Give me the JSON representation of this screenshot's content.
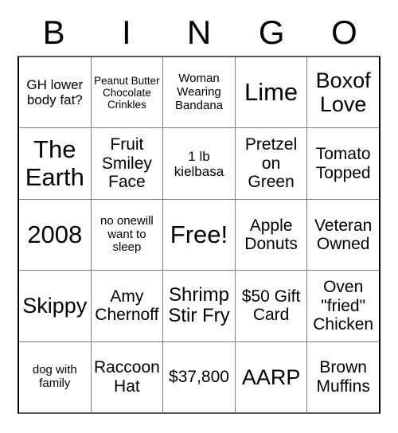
{
  "card": {
    "title_letters": [
      "B",
      "I",
      "N",
      "G",
      "O"
    ],
    "columns": [
      "B",
      "I",
      "N",
      "G",
      "O"
    ],
    "free_space_label": "Free!",
    "colors": {
      "text": "#000000",
      "background": "#ffffff",
      "grid_line": "#808080",
      "outer_border": "#000000"
    },
    "rows": [
      [
        {
          "text": "GH lower body fat?",
          "size": "sm"
        },
        {
          "text": "Peanut Butter Chocolate Crinkles",
          "size": "xxs"
        },
        {
          "text": "Woman Wearing Bandana",
          "size": "xs"
        },
        {
          "text": "Lime",
          "size": "xxl"
        },
        {
          "text": "Boxof Love",
          "size": "xl"
        }
      ],
      [
        {
          "text": "The Earth",
          "size": "xxl"
        },
        {
          "text": "Fruit Smiley Face",
          "size": "md"
        },
        {
          "text": "1 lb kielbasa",
          "size": "sm"
        },
        {
          "text": "Pretzel on Green",
          "size": "md"
        },
        {
          "text": "Tomato Topped",
          "size": "md"
        }
      ],
      [
        {
          "text": "2008",
          "size": "xxl"
        },
        {
          "text": "no onewill want to sleep",
          "size": "xs"
        },
        {
          "text": "Free!",
          "size": "xxl"
        },
        {
          "text": "Apple Donuts",
          "size": "md"
        },
        {
          "text": "Veteran Owned",
          "size": "md"
        }
      ],
      [
        {
          "text": "Skippy",
          "size": "xl"
        },
        {
          "text": "Amy Chernoff",
          "size": "md"
        },
        {
          "text": "Shrimp Stir Fry",
          "size": "lg"
        },
        {
          "text": "$50 Gift Card",
          "size": "md"
        },
        {
          "text": "Oven \"fried\" Chicken",
          "size": "md"
        }
      ],
      [
        {
          "text": "dog with family",
          "size": "xs"
        },
        {
          "text": "Raccoon Hat",
          "size": "md"
        },
        {
          "text": "$37,800",
          "size": "md"
        },
        {
          "text": "AARP",
          "size": "xl"
        },
        {
          "text": "Brown Muffins",
          "size": "md"
        }
      ]
    ]
  }
}
